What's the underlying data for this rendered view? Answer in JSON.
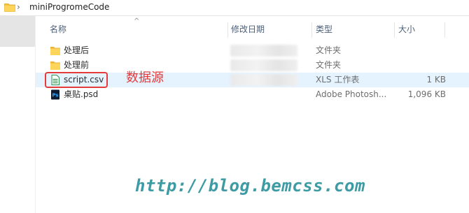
{
  "address_bar": {
    "separator": "›",
    "path": "miniProgromeCode",
    "folder_icon": "folder-icon"
  },
  "columns": {
    "name": "名称",
    "modified": "修改日期",
    "type": "类型",
    "size": "大小"
  },
  "files": [
    {
      "name": "处理后",
      "type": "文件夹",
      "size": "",
      "icon": "folder-icon",
      "selected": false
    },
    {
      "name": "处理前",
      "type": "文件夹",
      "size": "",
      "icon": "folder-icon",
      "selected": false
    },
    {
      "name": "script.csv",
      "type": "XLS 工作表",
      "size": "1 KB",
      "icon": "csv-file-icon",
      "selected": true
    },
    {
      "name": "桌贴.psd",
      "type": "Adobe Photosh...",
      "size": "1,096 KB",
      "icon": "psd-file-icon",
      "selected": false
    }
  ],
  "annotation": {
    "label": "数据源",
    "color": "#e53b3b"
  },
  "watermark": {
    "text": "http://blog.bemcss.com",
    "color": "#3d9ba3"
  }
}
